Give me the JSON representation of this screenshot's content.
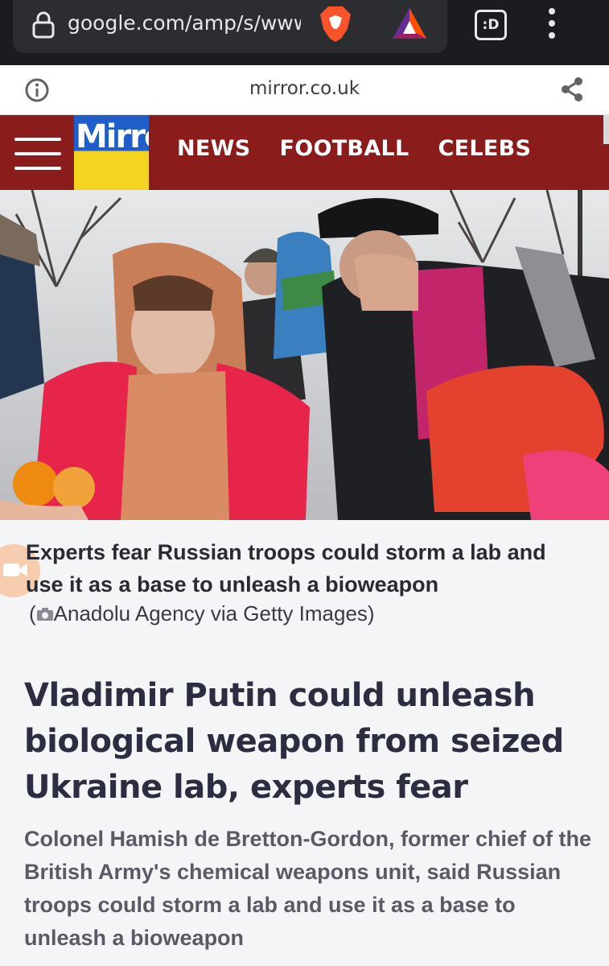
{
  "browser": {
    "url": "google.com/amp/s/www",
    "tabs_label": ":D",
    "icons": [
      "lock-icon",
      "brave-lion-icon",
      "brave-rewards-icon",
      "tabs-icon",
      "menu-dots-icon"
    ]
  },
  "amp_viewer": {
    "domain": "mirror.co.uk",
    "icons": [
      "info-icon",
      "share-icon"
    ]
  },
  "site_nav": {
    "logo_text": "Mirror",
    "links": [
      "NEWS",
      "FOOTBALL",
      "CELEBS"
    ],
    "colors": {
      "bar": "#8b1c1c",
      "logo_top": "#1f5ec9",
      "logo_bottom": "#f4d321"
    }
  },
  "article": {
    "image_caption": "Experts fear Russian troops could storm a lab and use it as a base to unleash a bioweapon",
    "image_credit_open": "(",
    "image_credit": "Anadolu Agency via Getty Images)",
    "headline": "Vladimir Putin could unleash biological weapon from seized Ukraine lab, experts fear",
    "standfirst": "Colonel Hamish de Bretton-Gordon, former chief of the British Army's chemical weapons unit, said Russian troops could storm a lab and use it as a base to unleash a bioweapon"
  }
}
